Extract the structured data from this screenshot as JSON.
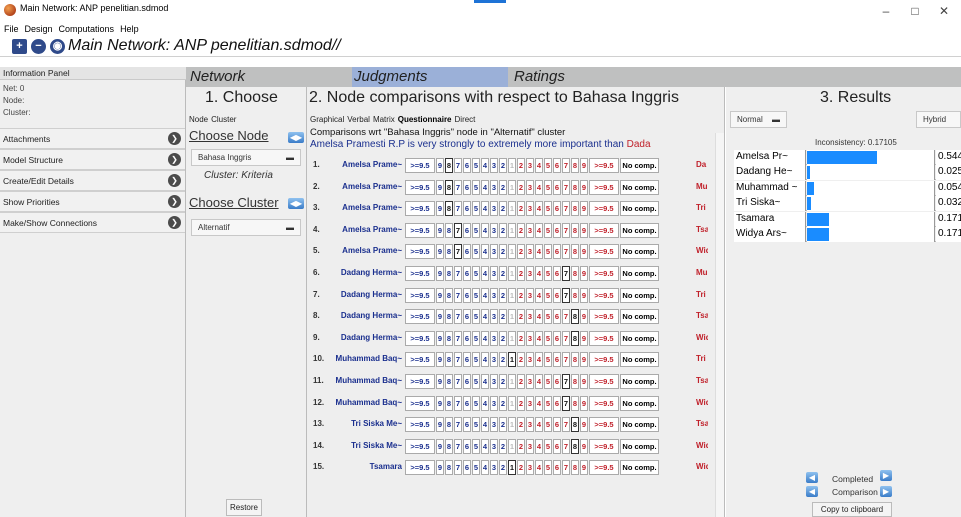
{
  "window": {
    "title": "Main Network: ANP penelitian.sdmod",
    "controls": {
      "minimize": "–",
      "maximize": "□",
      "close": "✕"
    }
  },
  "menubar": [
    "File",
    "Design",
    "Computations",
    "Help"
  ],
  "toolbar": {
    "network_title": "Main Network: ANP penelitian.sdmod//"
  },
  "left_panel": {
    "header": "Information Panel",
    "info": [
      "Net: 0",
      "Node:",
      "Cluster:"
    ],
    "buttons": [
      "Attachments",
      "Model Structure",
      "Create/Edit Details",
      "Show Priorities",
      "Make/Show Connections"
    ]
  },
  "header_tabs": {
    "network": "Network",
    "judgments": "Judgments",
    "ratings": "Ratings"
  },
  "choose": {
    "title": "1. Choose",
    "subtabs": [
      "Node",
      "Cluster"
    ],
    "choose_node_label": "Choose Node",
    "node_value": "Bahasa Inggris",
    "cluster_caption": "Cluster: Kriteria",
    "choose_cluster_label": "Choose Cluster",
    "cluster_value": "Alternatif",
    "restore": "Restore"
  },
  "comparisons": {
    "title": "2. Node comparisons with respect to Bahasa Inggris",
    "plus": "+",
    "subtabs": [
      "Graphical",
      "Verbal",
      "Matrix",
      "Questionnaire",
      "Direct"
    ],
    "wrt_line": "Comparisons wrt \"Bahasa Inggris\" node in \"Alternatif\" cluster",
    "verbal_line_blue": "Amelsa Pramesti R.P is very strongly to extremely more important than",
    "verbal_line_red": "Dada",
    "scale_left": [
      ">=9.5",
      "9",
      "8",
      "7",
      "6",
      "5",
      "4",
      "3",
      "2"
    ],
    "scale_one": "1",
    "scale_right": [
      "2",
      "3",
      "4",
      "5",
      "6",
      "7",
      "8",
      "9",
      ">=9.5"
    ],
    "no_comp": "No comp.",
    "rows": [
      {
        "num": "1.",
        "left": "Amelsa Prame~",
        "right": "Da",
        "selected": "L8"
      },
      {
        "num": "2.",
        "left": "Amelsa Prame~",
        "right": "Mu",
        "selected": "L8"
      },
      {
        "num": "3.",
        "left": "Amelsa Prame~",
        "right": "Tri",
        "selected": "L8"
      },
      {
        "num": "4.",
        "left": "Amelsa Prame~",
        "right": "Tsa",
        "selected": "L7"
      },
      {
        "num": "5.",
        "left": "Amelsa Prame~",
        "right": "Wid",
        "selected": "L7"
      },
      {
        "num": "6.",
        "left": "Dadang Herma~",
        "right": "Mu",
        "selected": "R7"
      },
      {
        "num": "7.",
        "left": "Dadang Herma~",
        "right": "Tri",
        "selected": "R7"
      },
      {
        "num": "8.",
        "left": "Dadang Herma~",
        "right": "Tsa",
        "selected": "R8"
      },
      {
        "num": "9.",
        "left": "Dadang Herma~",
        "right": "Wid",
        "selected": "R8"
      },
      {
        "num": "10.",
        "left": "Muhammad Baq~",
        "right": "Tri",
        "selected": "ONE"
      },
      {
        "num": "11.",
        "left": "Muhammad Baq~",
        "right": "Tsa",
        "selected": "R7"
      },
      {
        "num": "12.",
        "left": "Muhammad Baq~",
        "right": "Wid",
        "selected": "R7"
      },
      {
        "num": "13.",
        "left": "Tri Siska Me~",
        "right": "Tsa",
        "selected": "R8"
      },
      {
        "num": "14.",
        "left": "Tri Siska Me~",
        "right": "Wid",
        "selected": "R8"
      },
      {
        "num": "15.",
        "left": "Tsamara",
        "right": "Wid",
        "selected": "ONE"
      }
    ]
  },
  "results": {
    "title": "3. Results",
    "mode_left": "Normal",
    "mode_right": "Hybrid",
    "inconsistency": "Inconsistency: 0.17105",
    "rows": [
      {
        "name": "Amelsa Pr~",
        "value": "0.544",
        "fraction": 0.544
      },
      {
        "name": "Dadang He~",
        "value": "0.025",
        "fraction": 0.025
      },
      {
        "name": "Muhammad ~",
        "value": "0.054",
        "fraction": 0.054
      },
      {
        "name": "Tri Siska~",
        "value": "0.032",
        "fraction": 0.032
      },
      {
        "name": "Tsamara",
        "value": "0.171",
        "fraction": 0.171
      },
      {
        "name": "Widya Ars~",
        "value": "0.171",
        "fraction": 0.171
      }
    ],
    "completed": "Completed",
    "comparison": "Comparison",
    "copy": "Copy to clipboard"
  }
}
